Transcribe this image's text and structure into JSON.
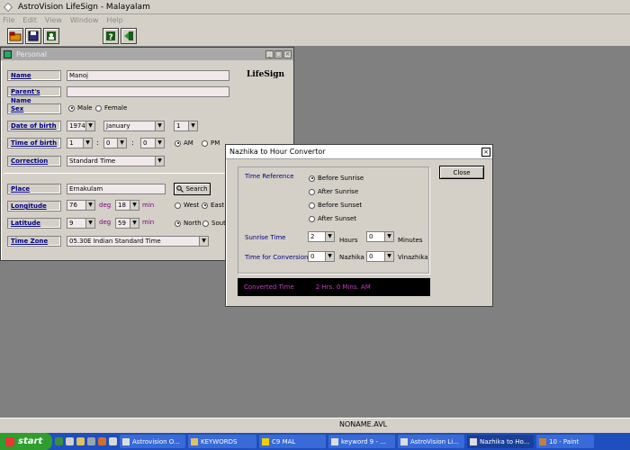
{
  "app": {
    "title": "AstroVision LifeSign - Malayalam",
    "menu": [
      "File",
      "Edit",
      "View",
      "Window",
      "Help"
    ]
  },
  "toolbar": {
    "icons": [
      "open-folder-icon",
      "save-icon",
      "person-icon",
      "help-icon",
      "exit-icon"
    ]
  },
  "personal": {
    "title": "Personal",
    "brand": "LifeSign",
    "labels": {
      "name": "Name",
      "parents_name": "Parent's Name",
      "sex": "Sex",
      "date_of_birth": "Date of birth",
      "time_of_birth": "Time of birth",
      "correction": "Correction",
      "place": "Place",
      "longitude": "Longitude",
      "latitude": "Latitude",
      "time_zone": "Time Zone"
    },
    "values": {
      "name": "Manoj",
      "parents_name": "",
      "sex_male": "Male",
      "sex_female": "Female",
      "year": "1974",
      "month": "January",
      "day": "1",
      "hour": "1",
      "minute": "0",
      "second": "0",
      "am": "AM",
      "pm": "PM",
      "correction": "Standard Time",
      "place": "Ernakulam",
      "search": "Search",
      "long_deg": "76",
      "long_min": "18",
      "west": "West",
      "east": "East",
      "lat_deg": "9",
      "lat_min": "59",
      "north": "North",
      "south": "South",
      "time_zone": "05.30E  Indian Standard Time",
      "deg": "deg",
      "min": "min",
      "colon": ":"
    }
  },
  "nazhika": {
    "title": "Nazhika to Hour Convertor",
    "close": "Close",
    "time_reference": "Time Reference",
    "options": [
      "Before Sunrise",
      "After Sunrise",
      "Before Sunset",
      "After Sunset"
    ],
    "sunrise_time": "Sunrise Time",
    "sunrise_hours": "2",
    "hours_unit": "Hours",
    "sunrise_minutes": "0",
    "minutes_unit": "Minutes",
    "time_for_conversion": "Time for Conversion",
    "nazhika_value": "0",
    "nazhika_unit": "Nazhika",
    "vinazhika_value": "0",
    "vinazhika_unit": "Vinazhika",
    "converted_label": "Converted Time",
    "converted_value": "2 Hrs.  0 Mins.  AM"
  },
  "status": {
    "file": "NONAME.AVL"
  },
  "taskbar": {
    "start": "start",
    "tasks": [
      "Astrovision O...",
      "KEYWORDS",
      "C9 MAL",
      "keyword 9 - ...",
      "AstroVision Li...",
      "Nazhika to Ho...",
      "10 - Paint"
    ]
  }
}
